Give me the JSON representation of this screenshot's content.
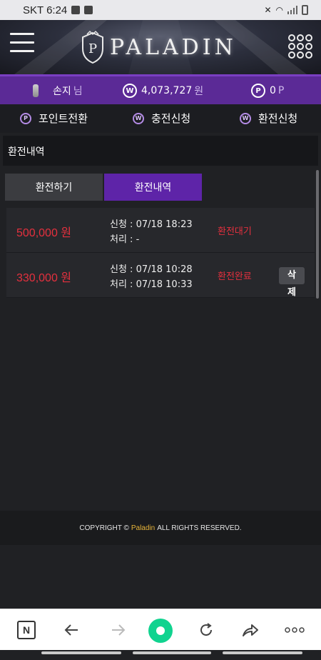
{
  "status_bar": {
    "carrier_time": "SKT 6:24"
  },
  "header": {
    "logo_text": "PALADIN",
    "logo_crest_letter": "P"
  },
  "info_bar": {
    "user_name": "손지",
    "user_suffix": "님",
    "cash_badge": "W",
    "cash_amount": "4,073,727",
    "cash_unit": "원",
    "point_badge": "P",
    "point_amount": "0",
    "point_unit": "P"
  },
  "nav": {
    "items": [
      {
        "icon": "P",
        "label": "포인트전환"
      },
      {
        "icon": "W",
        "label": "충전신청"
      },
      {
        "icon": "W",
        "label": "환전신청"
      }
    ]
  },
  "page_title": "환전내역",
  "tabs": {
    "exchange": "환전하기",
    "history": "환전내역"
  },
  "rows": [
    {
      "amount": "500,000 원",
      "requested": "신청 : 07/18 18:23",
      "processed": "처리 : -",
      "status": "환전대기"
    },
    {
      "amount": "330,000 원",
      "requested": "신청 : 07/18 10:28",
      "processed": "처리 : 07/18 10:33",
      "status": "환전완료",
      "delete_1": "삭",
      "delete_2": "제"
    }
  ],
  "footer": {
    "prefix": "COPYRIGHT ©",
    "brand": "Paladin",
    "suffix": "ALL RIGHTS RESERVED."
  },
  "browser_bar": {
    "n_label": "N"
  },
  "colors": {
    "accent_purple": "#5b2a96",
    "tab_active": "#5e24a8",
    "amount_red": "#e5303e",
    "footer_brand": "#e7b43a",
    "home_green": "#10d38f"
  }
}
